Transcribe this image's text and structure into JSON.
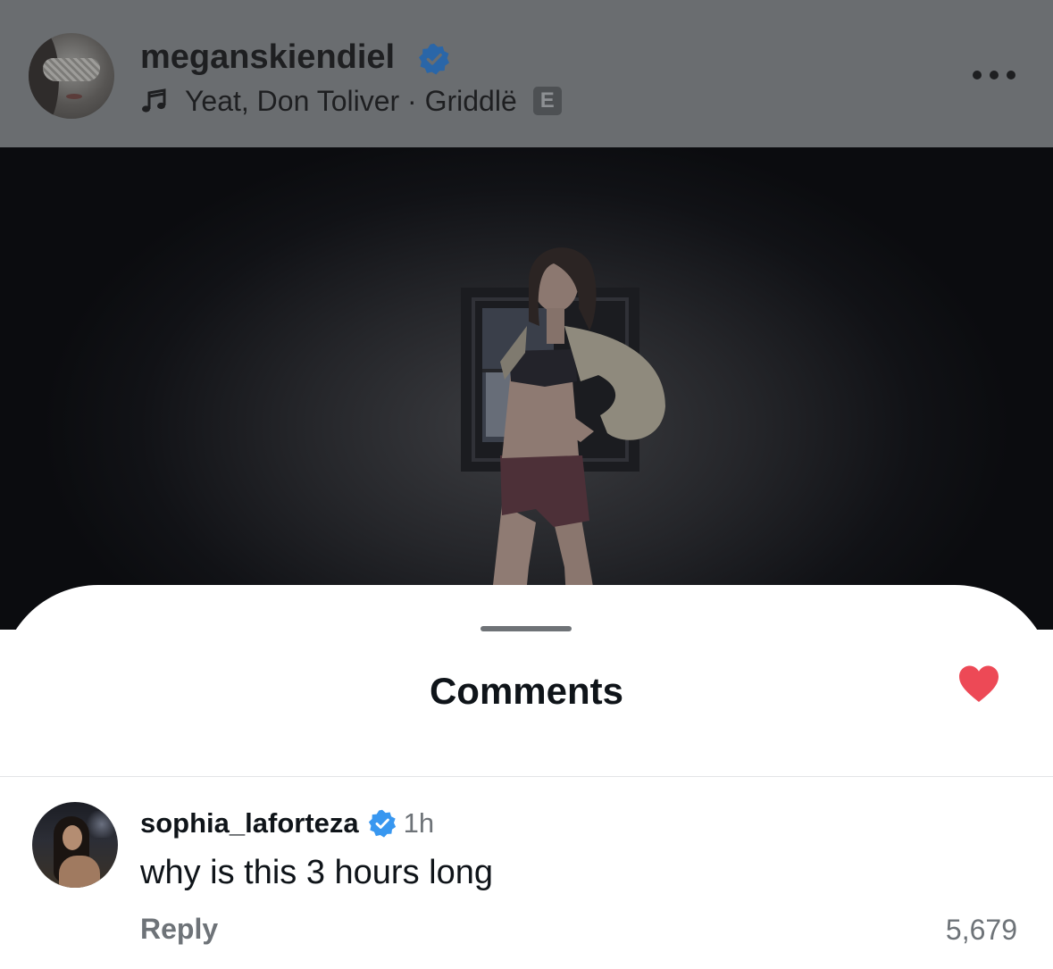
{
  "post_header": {
    "username": "meganskiendiel",
    "audio_text": "Yeat, Don Toliver · Griddlë",
    "explicit_badge": "E",
    "icons": {
      "verified": "verified-badge-icon",
      "music": "music-note-icon",
      "more": "more-options-icon"
    }
  },
  "comments_sheet": {
    "title": "Comments",
    "comments": [
      {
        "username": "sophia_laforteza",
        "time": "1h",
        "text": "why is this 3 hours long",
        "reply_label": "Reply",
        "like_count": "5,679",
        "liked": true
      }
    ]
  },
  "colors": {
    "header_dim": "#6a6d70",
    "verified_blue": "#3897f0",
    "verified_blue_dimmed": "#2a66a8",
    "heart_red": "#ed4956",
    "secondary_text": "#6e7378",
    "primary_text": "#0f1419"
  }
}
